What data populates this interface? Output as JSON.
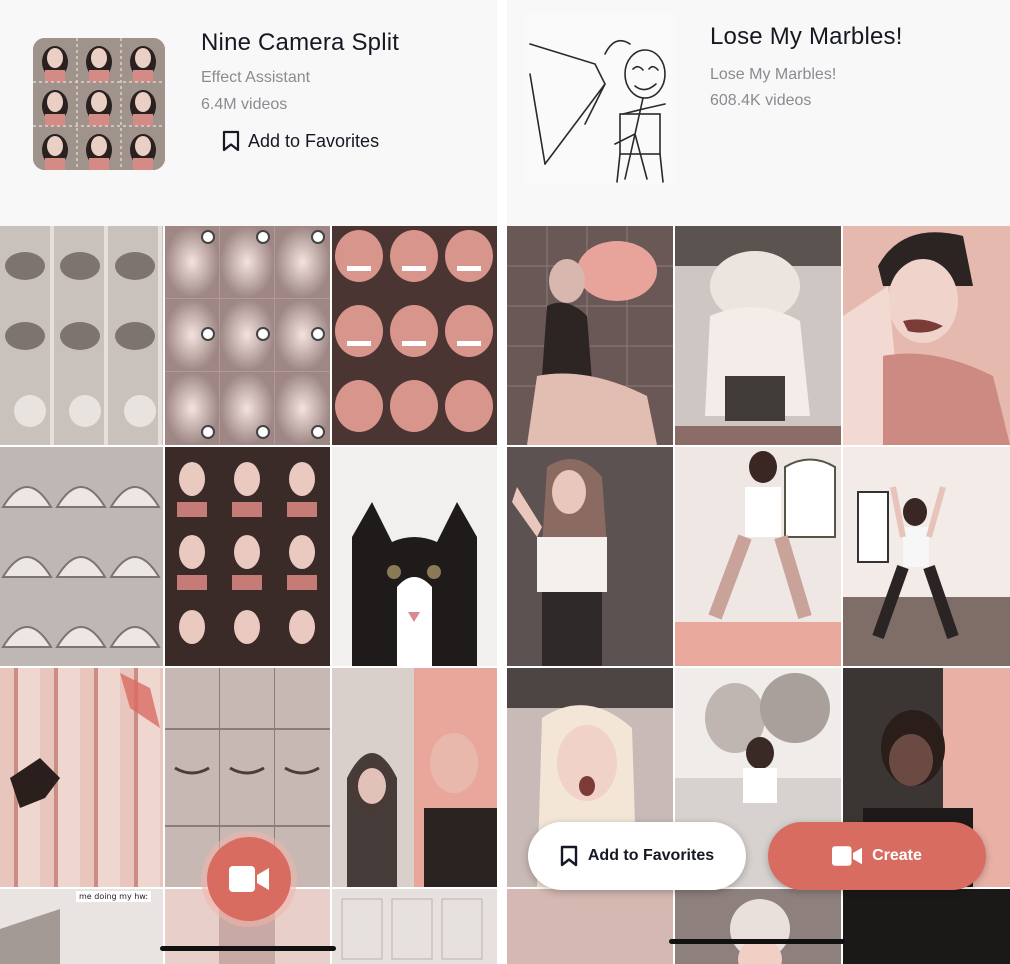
{
  "left": {
    "title": "Nine Camera Split",
    "subtitle": "Effect Assistant",
    "video_count": "6.4M videos",
    "favorites_label": "Add to Favorites",
    "cell_caption": "me doing my hw:",
    "record_button_icon": "video-camera-icon"
  },
  "right": {
    "title": "Lose My Marbles!",
    "subtitle": "Lose My Marbles!",
    "video_count": "608.4K videos",
    "favorites_button_label": "Add to Favorites",
    "create_button_label": "Create",
    "create_icon": "video-camera-icon"
  },
  "colors": {
    "accent": "#d96c61",
    "text_primary": "#161823",
    "text_secondary": "#8a8b91",
    "header_bg": "#f8f8f8"
  }
}
